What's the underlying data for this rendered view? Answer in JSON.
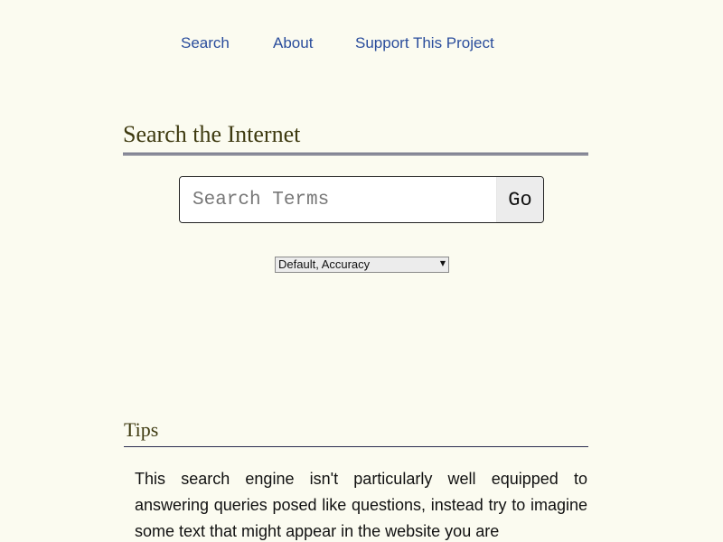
{
  "nav": {
    "items": [
      {
        "label": "Search"
      },
      {
        "label": "About"
      },
      {
        "label": "Support This Project"
      }
    ],
    "link_color": "#2a4d9c"
  },
  "search_section": {
    "heading": "Search the Internet",
    "input_placeholder": "Search Terms",
    "input_value": "",
    "go_label": "Go",
    "mode_select": {
      "selected": "Default, Accuracy"
    }
  },
  "tips_section": {
    "heading": "Tips",
    "text": "This search engine isn't particularly well equipped to answering queries posed like questions, instead try to imagine some text that might appear in the website you are"
  },
  "colors": {
    "background": "#fbfbf0",
    "heading": "#3e3a10",
    "rule": "#2a2d50"
  }
}
